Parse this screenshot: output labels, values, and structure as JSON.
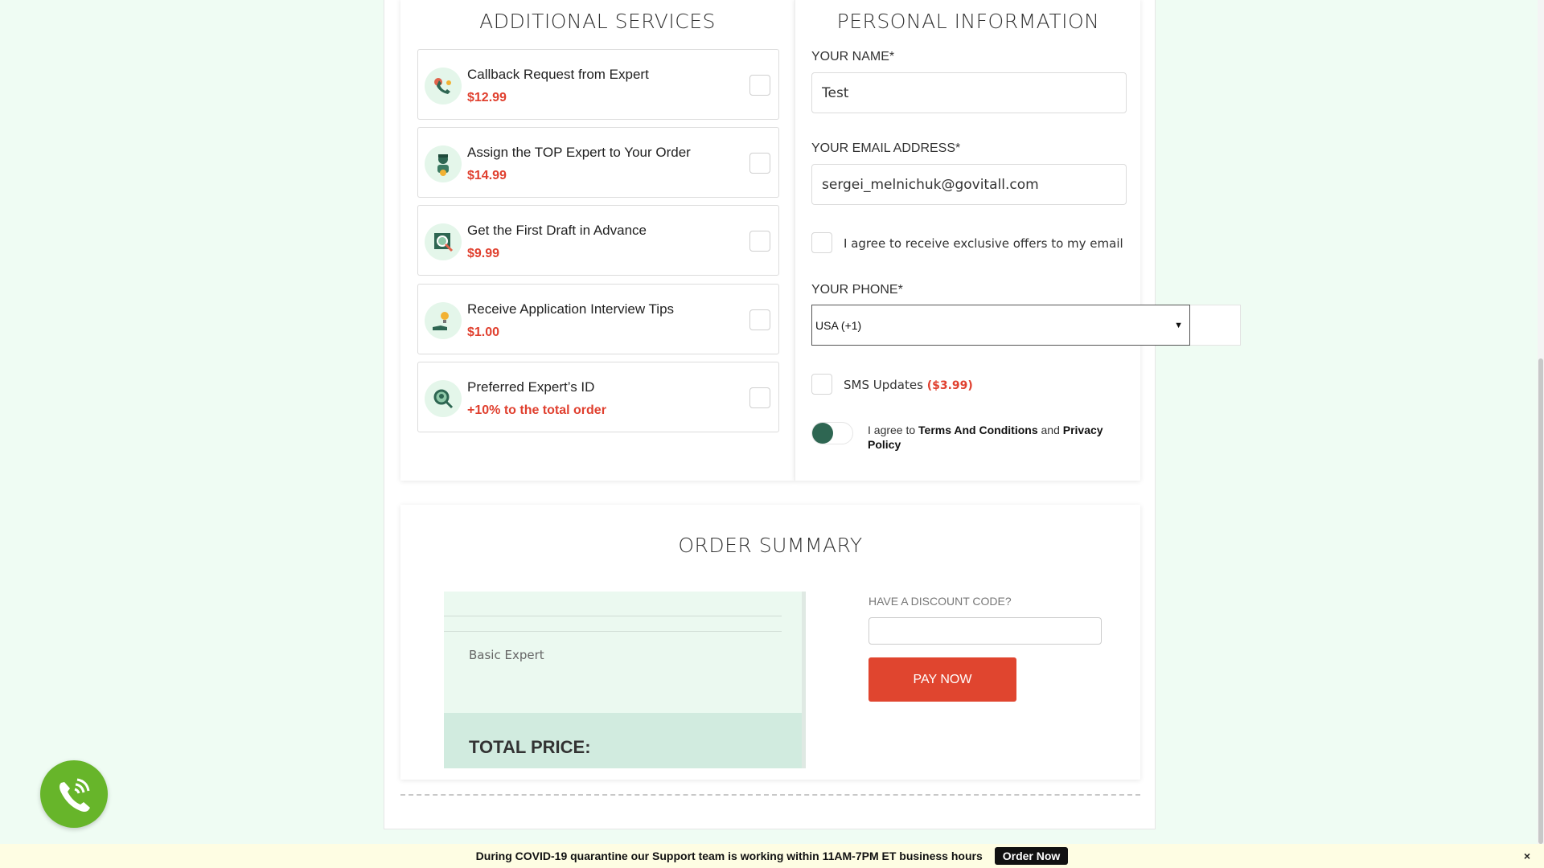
{
  "additional_services": {
    "title": "ADDITIONAL SERVICES",
    "items": [
      {
        "title": "Callback Request from Expert",
        "price": "$12.99",
        "icon": "phone-callback-icon"
      },
      {
        "title": "Assign the TOP Expert to Your Order",
        "price": "$14.99",
        "icon": "top-expert-icon"
      },
      {
        "title": "Get the First Draft in Advance",
        "price": "$9.99",
        "icon": "draft-magnifier-icon"
      },
      {
        "title": "Receive Application Interview Tips",
        "price": "$1.00",
        "icon": "lightbulb-tips-icon"
      },
      {
        "title": "Preferred Expert’s ID",
        "price": "+10% to the total order",
        "icon": "expert-id-icon"
      }
    ]
  },
  "personal_information": {
    "title": "PERSONAL INFORMATION",
    "name_label": "YOUR NAME*",
    "name_value": "Test",
    "email_label": "YOUR EMAIL ADDRESS*",
    "email_value": "sergei_melnichuk@govitall.com",
    "offers_label": "I agree to receive exclusive offers to my email",
    "phone_label": "YOUR PHONE*",
    "phone_country": "USA (+1)",
    "sms_label": "SMS Updates",
    "sms_price": "($3.99)",
    "terms_prefix": "I agree to",
    "terms_link": "Terms And Conditions",
    "terms_and": "and",
    "privacy_link": "Privacy Policy"
  },
  "order_summary": {
    "title": "ORDER SUMMARY",
    "item": "Basic Expert",
    "total_label": "TOTAL PRICE:",
    "discount_label": "HAVE A DISCOUNT CODE?",
    "pay_button": "PAY NOW"
  },
  "notice_bar": {
    "text": "During COVID-19 quarantine our Support team is working within 11AM-7PM ET business hours",
    "button": "Order Now",
    "close": "×"
  },
  "colors": {
    "accent_red": "#e0402f",
    "accent_green": "#2e6652",
    "call_button_green": "#67b52a",
    "page_background": "#effcf3"
  }
}
